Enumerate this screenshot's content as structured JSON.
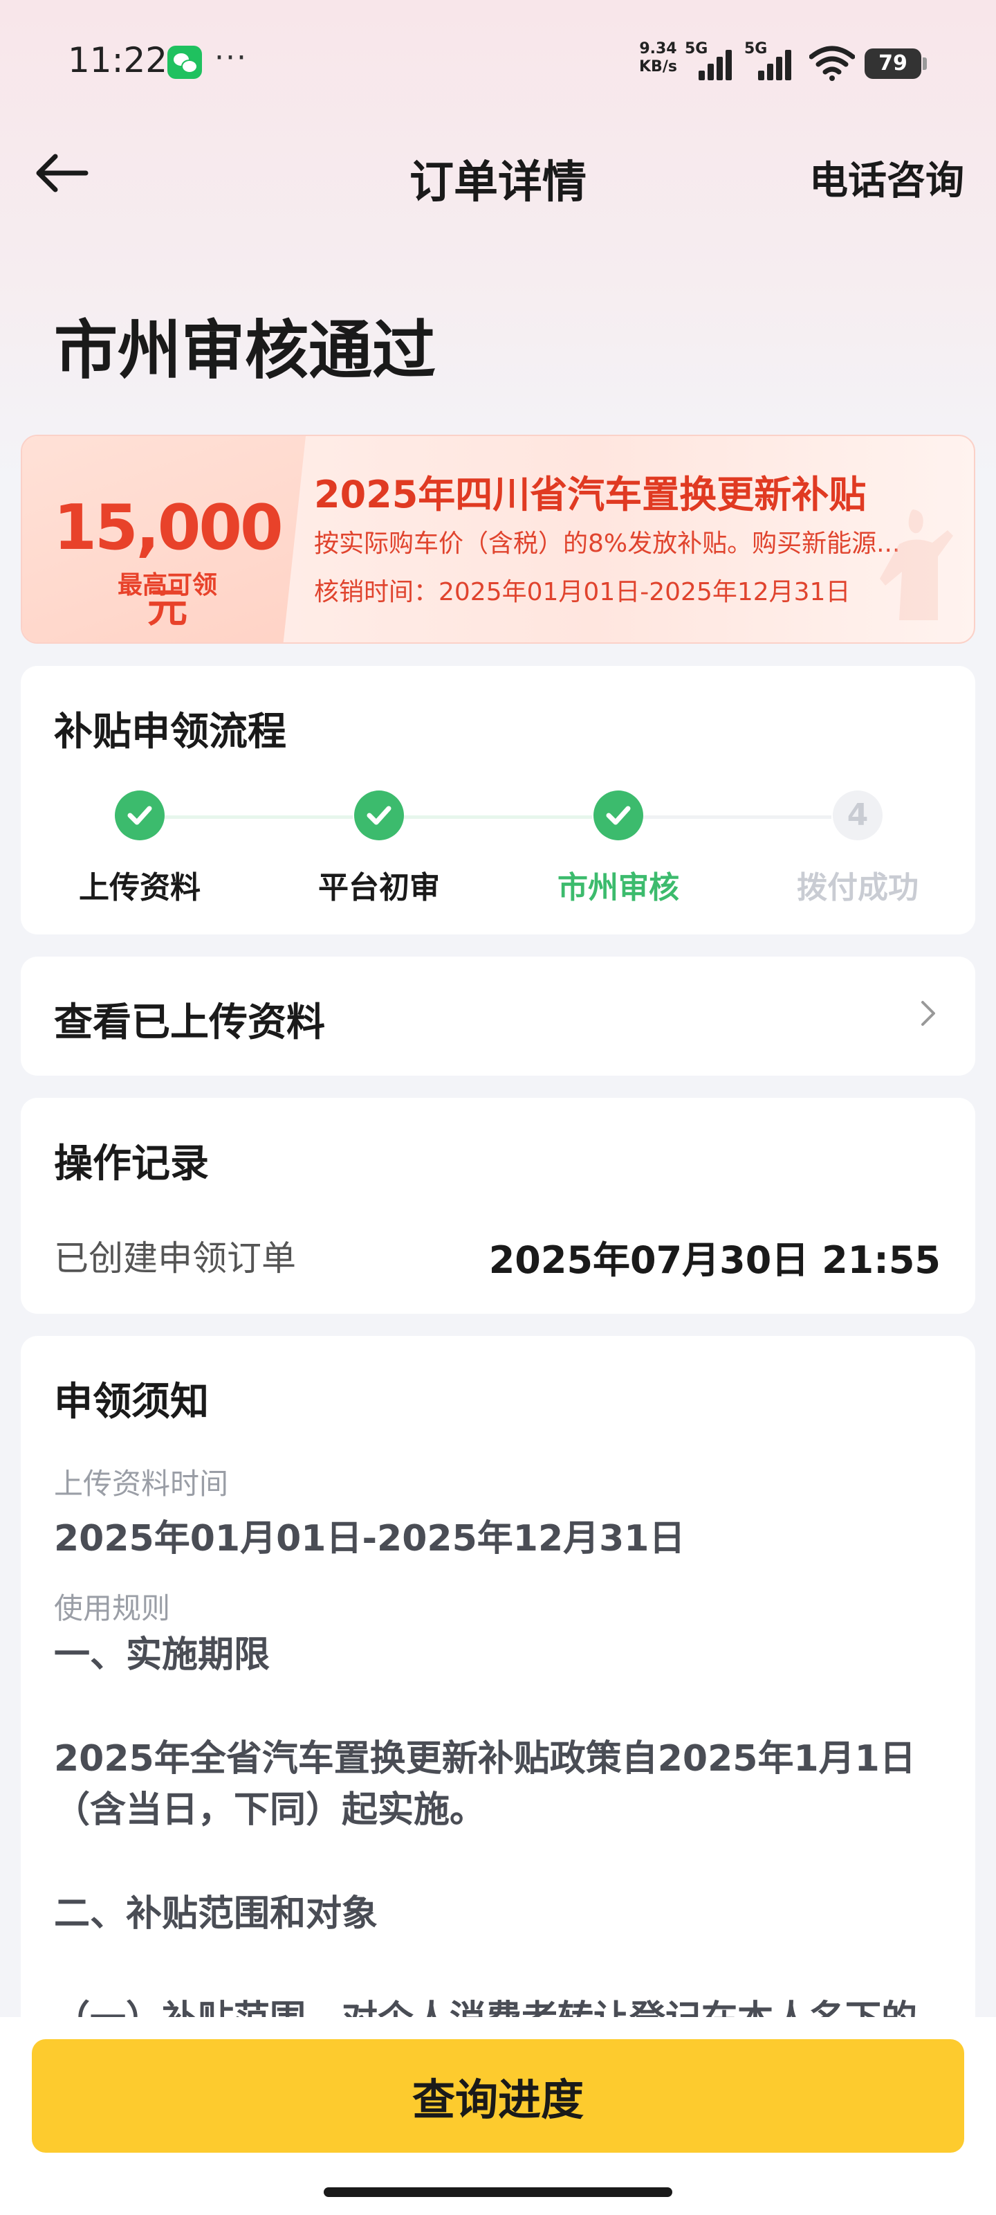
{
  "status_bar": {
    "time": "11:22",
    "more": "···",
    "net_speed_value": "9.34",
    "net_speed_unit": "KB/s",
    "sim1": "5G",
    "sim2": "5G",
    "battery": "79",
    "icons": [
      "wechat-icon",
      "signal-icon",
      "signal-icon",
      "wifi-icon",
      "battery-icon"
    ]
  },
  "header": {
    "title": "订单详情",
    "phone_label": "电话咨询",
    "back_icon": "arrow-left-icon"
  },
  "status_title": "市州审核通过",
  "banner": {
    "amount": "15,000",
    "amount_unit": "元",
    "amount_label": "最高可领",
    "title": "2025年四川省汽车置换更新补贴",
    "description": "按实际购车价（含税）的8%发放补贴。购买新能源...",
    "validity": "核销时间：2025年01月01日-2025年12月31日"
  },
  "process": {
    "title": "补贴申领流程",
    "steps": [
      {
        "label": "上传资料",
        "state": "done"
      },
      {
        "label": "平台初审",
        "state": "done"
      },
      {
        "label": "市州审核",
        "state": "active"
      },
      {
        "label": "拨付成功",
        "state": "pending",
        "number": "4"
      }
    ]
  },
  "uploaded": {
    "label": "查看已上传资料",
    "icon": "chevron-right-icon"
  },
  "records": {
    "title": "操作记录",
    "items": [
      {
        "label": "已创建申领订单",
        "time": "2025年07月30日 21:55"
      }
    ]
  },
  "notice": {
    "title": "申领须知",
    "upload_time_label": "上传资料时间",
    "upload_time_value": "2025年01月01日-2025年12月31日",
    "rules_label": "使用规则",
    "rules_heading_1": "一、实施期限",
    "rules_para_1": "2025年全省汽车置换更新补贴政策自2025年1月1日（含当日，下同）起实施。",
    "rules_heading_2": "二、补贴范围和对象",
    "rules_para_2_partial": "（一）补贴范围。对个人消费者转让登记在本人名下的"
  },
  "footer": {
    "button_label": "查询进度"
  },
  "colors": {
    "accent_green": "#3cbb6d",
    "banner_red": "#e8422a",
    "button_yellow": "#fdcb2e"
  }
}
